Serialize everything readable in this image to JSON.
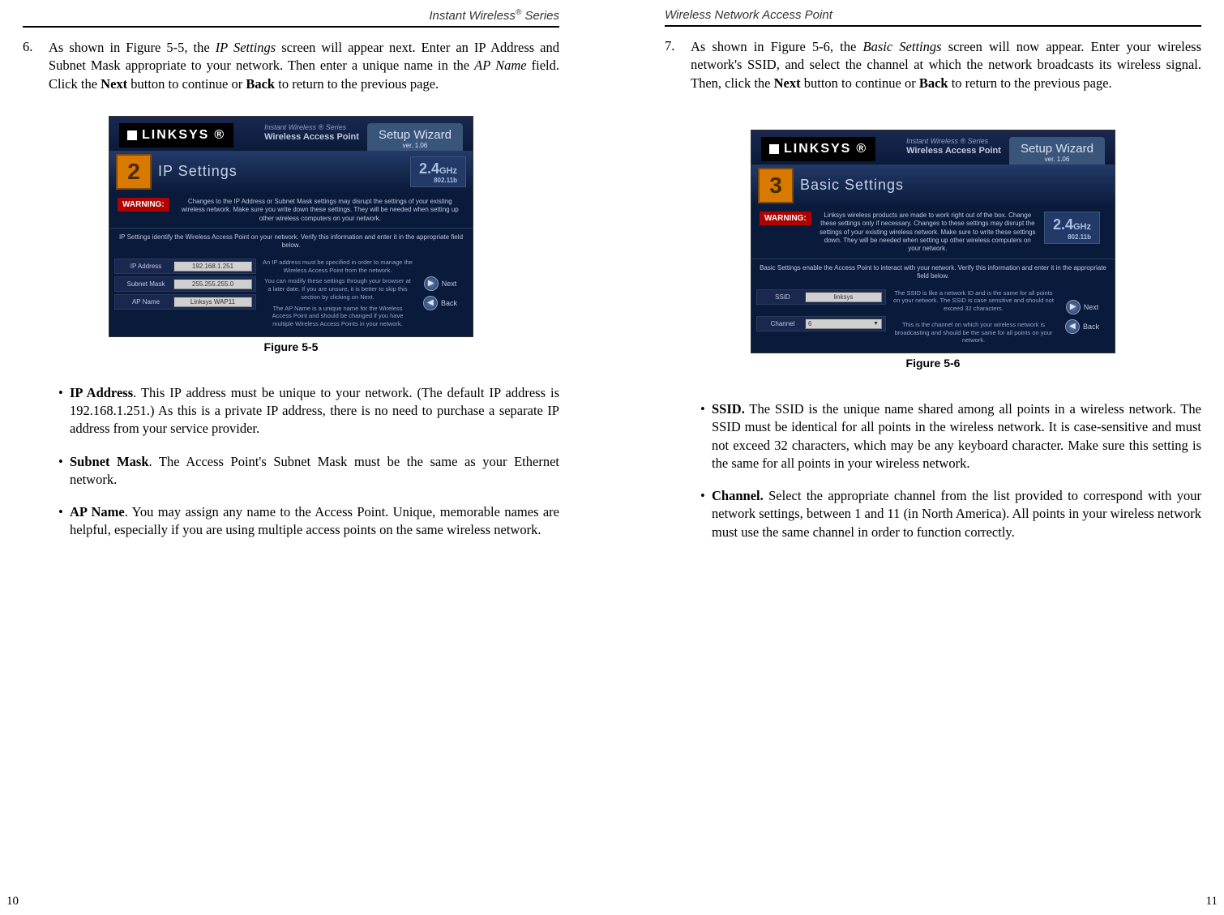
{
  "left": {
    "running_head_a": "Instant Wireless",
    "running_head_b": " Series",
    "step_num": "6.",
    "step_text_a": "As shown in Figure 5-5, the ",
    "step_text_b": "IP Settings",
    "step_text_c": " screen will appear next. Enter an IP Address and Subnet Mask appropriate to your network. Then enter a unique name in the ",
    "step_text_d": "AP Name",
    "step_text_e": " field. Click the ",
    "step_text_f": "Next",
    "step_text_g": " button to continue or ",
    "step_text_h": "Back",
    "step_text_i": " to return to the previous page.",
    "fig_caption": "Figure 5-5",
    "bullets": [
      {
        "lead": "IP Address",
        "rest": ". This IP address must be unique to your network. (The default IP address is 192.168.1.251.)  As this is a private IP address, there is no need to purchase a separate IP address from your service provider."
      },
      {
        "lead": "Subnet Mask",
        "rest": ". The Access Point's Subnet Mask must be the same as your Ethernet network."
      },
      {
        "lead": "AP Name",
        "rest": ". You may assign any name to the Access Point. Unique, memorable names are helpful, especially if you are using multiple access points on the same wireless network."
      }
    ],
    "page_num": "10"
  },
  "right": {
    "running_head": "Wireless Network Access Point",
    "step_num": "7.",
    "step_text_a": "As shown in Figure 5-6, the ",
    "step_text_b": "Basic Settings",
    "step_text_c": " screen will now appear. Enter your wireless network's SSID, and select the channel at which the network broadcasts its wireless signal. Then, click the ",
    "step_text_d": "Next",
    "step_text_e": " button to continue or ",
    "step_text_f": "Back",
    "step_text_g": " to return to the previous page.",
    "fig_caption": "Figure 5-6",
    "bullets": [
      {
        "lead": "SSID.",
        "rest": " The SSID is the unique name shared among all points in a wireless network. The SSID must be identical for all points in the wireless network. It is case-sensitive and must not exceed 32 characters, which may be any keyboard character. Make sure this setting is the same for all points in your wireless network."
      },
      {
        "lead": "Channel.",
        "rest": " Select the appropriate channel from the list provided to correspond with your network settings, between 1 and 11 (in North America). All points in your wireless network must use the same channel in order to function correctly."
      }
    ],
    "page_num": "11"
  },
  "shot5": {
    "logo": "LINKSYS",
    "series": "Instant Wireless ® Series",
    "product": "Wireless Access Point",
    "setup": "Setup Wizard",
    "ver": "ver. 1.06",
    "step_badge": "2",
    "title": "IP Settings",
    "ghz_big": "2.4",
    "ghz_lbl": "GHz",
    "ghz_std": "802.11b",
    "warning_label": "WARNING:",
    "warning_text": "Changes to the IP Address or Subnet Mask settings may disrupt the settings of your existing wireless network. Make sure you write down these settings. They will be needed when setting up other wireless computers on your network.",
    "info_text": "IP Settings identify the Wireless Access Point on your network. Verify this information and enter it in the appropriate field below.",
    "fields": [
      {
        "label": "IP Address",
        "value": "192.168.1.251"
      },
      {
        "label": "Subnet Mask",
        "value": "255.255.255.0"
      },
      {
        "label": "AP Name",
        "value": "Linksys WAP11"
      }
    ],
    "desc1": "An IP address must be specified in order to manage the Wireless Access Point from the network.",
    "desc2": "You can modify these settings through your browser at a later date. If you are unsure, it is better to skip this section by clicking on Next.",
    "desc3": "The AP Name is a unique name for the Wireless Access Point and should be changed if you have multiple Wireless Access Points in your network.",
    "next": "Next",
    "back": "Back"
  },
  "shot6": {
    "logo": "LINKSYS",
    "series": "Instant Wireless ® Series",
    "product": "Wireless Access Point",
    "setup": "Setup Wizard",
    "ver": "ver. 1.06",
    "step_badge": "3",
    "title": "Basic Settings",
    "ghz_big": "2.4",
    "ghz_lbl": "GHz",
    "ghz_std": "802.11b",
    "warning_label": "WARNING:",
    "warning_text": "Linksys wireless products are made to work right out of the box. Change these settings only if necessary. Changes to these settings may disrupt the settings of your existing wireless network. Make sure to write these settings down. They will be needed when setting up other wireless computers on your network.",
    "info_text": "Basic Settings enable the Access Point to interact with your network. Verify this information and enter it in the appropriate field below.",
    "fields": [
      {
        "label": "SSID",
        "value": "linksys"
      },
      {
        "label": "Channel",
        "value": "6"
      }
    ],
    "desc1": "The SSID is like a network ID and is the same for all points on your network. The SSID is case sensitive and should not exceed 32 characters.",
    "desc2": "This is the channel on which your wireless network is broadcasting and should be the same for all points on your network.",
    "next": "Next",
    "back": "Back"
  }
}
